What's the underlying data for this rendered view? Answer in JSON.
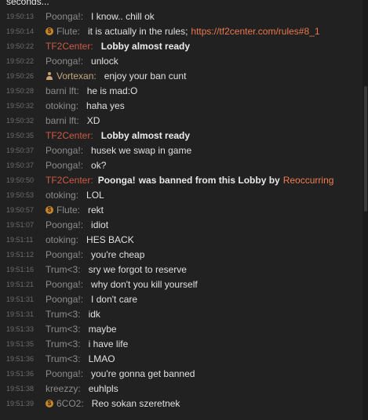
{
  "chat": {
    "partial_text": "seconds...",
    "lines": [
      {
        "ts": "19:50:13",
        "nick": "Poonga!:",
        "msg": "I know.. chill ok"
      },
      {
        "ts": "19:50:14",
        "icon": "coin-icon",
        "nick": "Flute:",
        "msg": "it is actually in the rules;",
        "link": "https://tf2center.com/rules#8_1"
      },
      {
        "ts": "19:50:22",
        "nick": "TF2Center:",
        "msg": "Lobby almost ready"
      },
      {
        "ts": "19:50:22",
        "nick": "Poonga!:",
        "msg": "unlock"
      },
      {
        "ts": "19:50:26",
        "icon": "user-icon",
        "nick": "Vortexan:",
        "msg": "enjoy your ban cunt"
      },
      {
        "ts": "19:50:28",
        "nick": "barni lft:",
        "msg": "he is mad:O"
      },
      {
        "ts": "19:50:32",
        "nick": "otoking:",
        "msg": "haha yes"
      },
      {
        "ts": "19:50:32",
        "nick": "barni lft:",
        "msg": "XD"
      },
      {
        "ts": "19:50:35",
        "nick": "TF2Center:",
        "msg": "Lobby almost ready"
      },
      {
        "ts": "19:50:37",
        "nick": "Poonga!:",
        "msg": "husek we swap in game"
      },
      {
        "ts": "19:50:37",
        "nick": "Poonga!:",
        "msg": "ok?"
      },
      {
        "ts": "19:50:50",
        "nick": "TF2Center:",
        "ban_user": "Poonga!",
        "msg": "was banned from this Lobby by",
        "ban_by": "Reoccurring"
      },
      {
        "ts": "19:50:53",
        "nick": "otoking:",
        "msg": "LOL"
      },
      {
        "ts": "19:50:57",
        "icon": "coin-icon",
        "nick": "Flute:",
        "msg": "rekt"
      },
      {
        "ts": "19:51:07",
        "nick": "Poonga!:",
        "msg": "idiot"
      },
      {
        "ts": "19:51:11",
        "nick": "otoking:",
        "msg": "HES BACK"
      },
      {
        "ts": "19:51:12",
        "nick": "Poonga!:",
        "msg": "you're cheap"
      },
      {
        "ts": "19:51:16",
        "nick": "Trum<3:",
        "msg": "sry we forgot to reserve"
      },
      {
        "ts": "19:51:21",
        "nick": "Poonga!:",
        "msg": "why don't you kill yourself"
      },
      {
        "ts": "19:51:31",
        "nick": "Poonga!:",
        "msg": "I don't care"
      },
      {
        "ts": "19:51:31",
        "nick": "Trum<3:",
        "msg": "idk"
      },
      {
        "ts": "19:51:33",
        "nick": "Trum<3:",
        "msg": "maybe"
      },
      {
        "ts": "19:51:35",
        "nick": "Trum<3:",
        "msg": "i have life"
      },
      {
        "ts": "19:51:36",
        "nick": "Trum<3:",
        "msg": "LMAO"
      },
      {
        "ts": "19:51:36",
        "nick": "Poonga!:",
        "msg": "you're gonna get banned"
      },
      {
        "ts": "19:51:38",
        "nick": "kreezzy:",
        "msg": "euhlpls"
      },
      {
        "ts": "19:51:39",
        "icon": "coin-icon",
        "nick": "6CO2:",
        "msg": "Reo sokan szeretnek"
      }
    ]
  },
  "icons": {
    "coin-icon": "$"
  },
  "colors": {
    "background": "#212121",
    "system_nick": "#d05a44",
    "link": "#e8784e",
    "ban_name": "#ef7e52",
    "coin": "#c8862a"
  }
}
